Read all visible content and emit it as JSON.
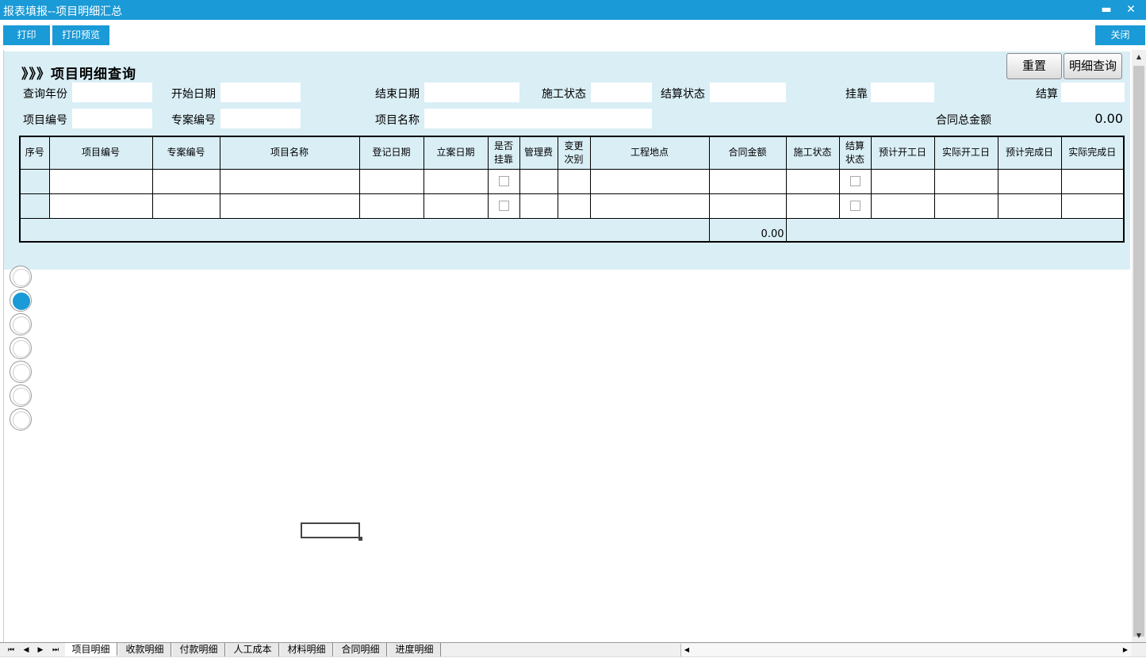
{
  "window": {
    "title": "报表填报--项目明细汇总",
    "minimize_glyph": "▬",
    "close_glyph": "✕"
  },
  "toolbar": {
    "print_label": "打印",
    "preview_label": "打印预览",
    "close_label": "关闭"
  },
  "form": {
    "heading": "》》》项目明细查询",
    "reset_label": "重置",
    "query_label": "明细查询",
    "labels": {
      "year": "查询年份",
      "start_date": "开始日期",
      "end_date": "结束日期",
      "construction_status": "施工状态",
      "settlement_status": "结算状态",
      "affiliated": "挂靠",
      "settlement": "结算",
      "project_code": "项目编号",
      "case_code": "专案编号",
      "project_name": "项目名称",
      "contract_total": "合同总金额"
    },
    "contract_total_value": "0.00"
  },
  "table": {
    "headers": {
      "seq": "序号",
      "project_code": "项目编号",
      "case_code": "专案编号",
      "project_name": "项目名称",
      "reg_date": "登记日期",
      "filing_date": "立案日期",
      "is_affiliated_1": "是否",
      "is_affiliated_2": "挂靠",
      "mgmt_fee": "管理费",
      "change_1": "变更",
      "change_2": "次别",
      "site": "工程地点",
      "contract_amount": "合同金额",
      "construction_status": "施工状态",
      "settle_1": "结算",
      "settle_2": "状态",
      "plan_start": "预计开工日",
      "actual_start": "实际开工日",
      "plan_finish": "预计完成日",
      "actual_finish": "实际完成日"
    },
    "sum_contract_amount": "0.00"
  },
  "radios": {
    "selected_index": 1
  },
  "sheet_tabs": {
    "tab1": "项目明细",
    "tab2": "收款明细",
    "tab3": "付款明细",
    "tab4": "人工成本",
    "tab5": "材料明细",
    "tab6": "合同明细",
    "tab7": "进度明细"
  },
  "nav": {
    "first": "⏮",
    "prev": "◀",
    "next": "▶",
    "last": "⏭"
  }
}
